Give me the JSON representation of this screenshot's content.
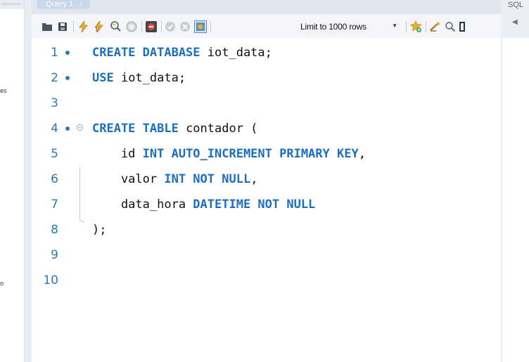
{
  "tab": {
    "label": "Query 1",
    "close": "×"
  },
  "toolbar": {
    "limit_label": "Limit to 1000 rows",
    "icons": [
      "open-folder-icon",
      "save-icon",
      "execute-icon",
      "execute-statement-icon",
      "explain-icon",
      "stop-icon",
      "toggle-error-icon",
      "commit-icon",
      "rollback-icon",
      "autocommit-icon",
      "add-snippet-icon",
      "beautify-icon",
      "find-icon",
      "invisible-chars-icon"
    ]
  },
  "right_pane": {
    "title": "SQL",
    "arrow": "◀"
  },
  "left_pane": {
    "fragment_1": "es",
    "fragment_2": "o"
  },
  "editor": {
    "lines": [
      {
        "n": "1",
        "dot": true,
        "fold": false,
        "tokens": [
          {
            "t": "CREATE DATABASE",
            "k": true
          },
          {
            "t": " iot_data;",
            "k": false
          }
        ]
      },
      {
        "n": "2",
        "dot": true,
        "fold": false,
        "tokens": [
          {
            "t": "USE",
            "k": true
          },
          {
            "t": " iot_data;",
            "k": false
          }
        ]
      },
      {
        "n": "3",
        "dot": false,
        "fold": false,
        "tokens": []
      },
      {
        "n": "4",
        "dot": true,
        "fold": true,
        "tokens": [
          {
            "t": "CREATE TABLE",
            "k": true
          },
          {
            "t": " contador (",
            "k": false
          }
        ]
      },
      {
        "n": "5",
        "dot": false,
        "fold": false,
        "tokens": [
          {
            "t": "    id ",
            "k": false
          },
          {
            "t": "INT AUTO_INCREMENT PRIMARY KEY",
            "k": true
          },
          {
            "t": ",",
            "k": false
          }
        ]
      },
      {
        "n": "6",
        "dot": false,
        "fold": false,
        "tokens": [
          {
            "t": "    valor ",
            "k": false
          },
          {
            "t": "INT NOT NULL",
            "k": true
          },
          {
            "t": ",",
            "k": false
          }
        ]
      },
      {
        "n": "7",
        "dot": false,
        "fold": false,
        "tokens": [
          {
            "t": "    data_hora ",
            "k": false
          },
          {
            "t": "DATETIME NOT NULL",
            "k": true
          }
        ]
      },
      {
        "n": "8",
        "dot": false,
        "fold": false,
        "tokens": [
          {
            "t": ");",
            "k": false
          }
        ]
      },
      {
        "n": "9",
        "dot": false,
        "fold": false,
        "tokens": []
      },
      {
        "n": "10",
        "dot": false,
        "fold": false,
        "tokens": []
      }
    ]
  },
  "colors": {
    "keyword": "#1b6fc2",
    "line_number": "#2c7bb0",
    "text": "#111111"
  }
}
